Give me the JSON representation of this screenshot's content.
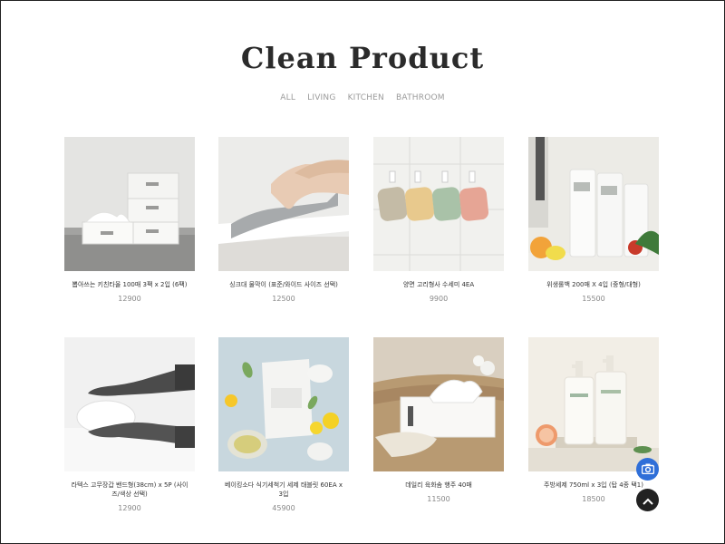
{
  "page": {
    "title": "Clean Product",
    "filters": [
      "ALL",
      "LIVING",
      "KITCHEN",
      "BATHROOM"
    ]
  },
  "products": [
    {
      "name": "뽑아쓰는 키친타올 100매 3팩 x 2입 (6팩)",
      "price": "12900"
    },
    {
      "name": "싱크대 물막이 (표준/와이드 사이즈 선택)",
      "price": "12500"
    },
    {
      "name": "양면 고리형사 수세미 4EA",
      "price": "9900"
    },
    {
      "name": "위생롤백 200매 X 4입 (중형/대형)",
      "price": "15500"
    },
    {
      "name": "라텍스 고무장갑 밴드형(38cm) x 5P (사이즈/색상 선택)",
      "price": "12900"
    },
    {
      "name": "베이킹소다 식기세척기 세제 태블릿 60EA x 3입",
      "price": "45900"
    },
    {
      "name": "데일리 육화솜 행주 40매",
      "price": "11500"
    },
    {
      "name": "주방세제 750ml x 3입 (탑 4종 택1)",
      "price": "18500"
    }
  ],
  "icons": {
    "camera": "camera-icon",
    "scroll_top": "chevron-up-icon"
  },
  "colors": {
    "camera_button": "#2f6fd8",
    "top_button": "#222222"
  }
}
